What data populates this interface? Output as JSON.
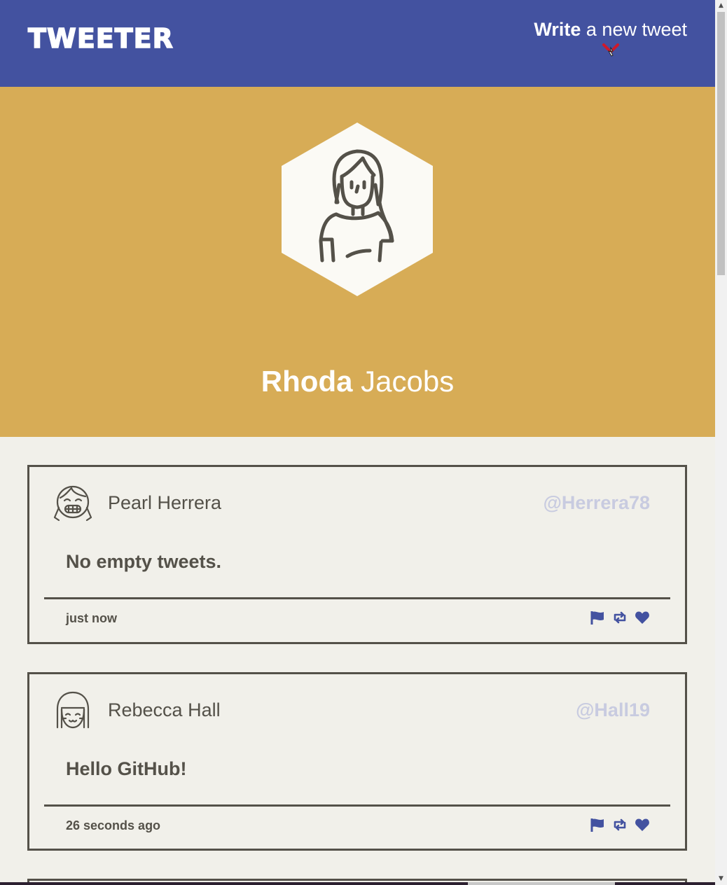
{
  "app": {
    "logo": "TWEETER",
    "compose_bold": "Write",
    "compose_rest": " a new tweet"
  },
  "profile": {
    "first_name": "Rhoda",
    "last_name": "Jacobs"
  },
  "tweets": [
    {
      "author": "Pearl Herrera",
      "handle": "@Herrera78",
      "content": "No empty tweets.",
      "timestamp": "just now",
      "avatar_icon": "laughing-girl-avatar-icon"
    },
    {
      "author": "Rebecca Hall",
      "handle": "@Hall19",
      "content": "Hello GitHub!",
      "timestamp": "26 seconds ago",
      "avatar_icon": "smiling-girl-avatar-icon"
    }
  ],
  "actions": [
    "flag-icon",
    "retweet-icon",
    "heart-icon"
  ],
  "colors": {
    "nav": "#4352a0",
    "header": "#d7ac56",
    "body": "#f1f0ea",
    "text": "#545149",
    "handle": "#c8cbe0",
    "accent": "#4352a0",
    "chevron": "#d0182a"
  }
}
